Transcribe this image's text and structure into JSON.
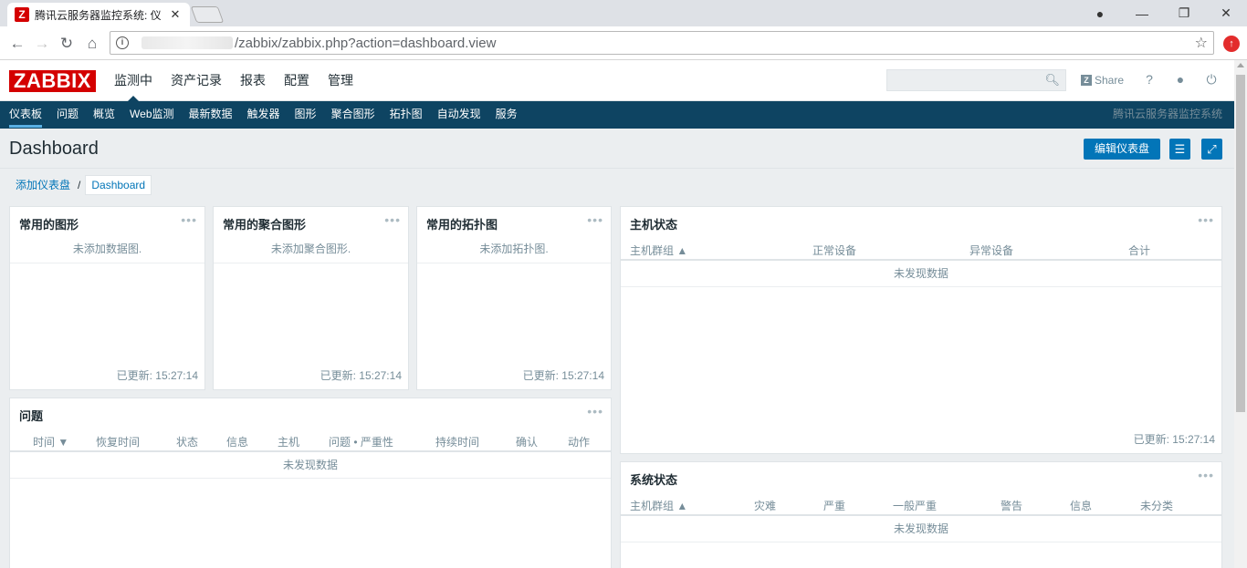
{
  "browser": {
    "tab_title": "腾讯云服务器监控系统: 仪",
    "favicon_letter": "Z",
    "url_path": "/zabbix/zabbix.php?action=dashboard.view"
  },
  "header": {
    "logo": "ZABBIX",
    "menu": [
      "监测中",
      "资产记录",
      "报表",
      "配置",
      "管理"
    ],
    "share_label": "Share",
    "help_label": "?"
  },
  "subnav": {
    "items": [
      "仪表板",
      "问题",
      "概览",
      "Web监测",
      "最新数据",
      "触发器",
      "图形",
      "聚合图形",
      "拓扑图",
      "自动发现",
      "服务"
    ],
    "server_name": "腾讯云服务器监控系统"
  },
  "page": {
    "title": "Dashboard",
    "edit_button": "编辑仪表盘",
    "breadcrumb_link": "添加仪表盘",
    "breadcrumb_current": "Dashboard"
  },
  "widgets": {
    "fav_graphs": {
      "title": "常用的图形",
      "empty": "未添加数据图.",
      "footer": "已更新: 15:27:14"
    },
    "fav_screens": {
      "title": "常用的聚合图形",
      "empty": "未添加聚合图形.",
      "footer": "已更新: 15:27:14"
    },
    "fav_maps": {
      "title": "常用的拓扑图",
      "empty": "未添加拓扑图.",
      "footer": "已更新: 15:27:14"
    },
    "host_status": {
      "title": "主机状态",
      "columns": [
        "主机群组 ▲",
        "正常设备",
        "异常设备",
        "合计"
      ],
      "empty": "未发现数据",
      "footer": "已更新: 15:27:14"
    },
    "problems": {
      "title": "问题",
      "columns": [
        "时间 ▼",
        "恢复时间",
        "状态",
        "信息",
        "主机",
        "问题 • 严重性",
        "持续时间",
        "确认",
        "动作"
      ],
      "empty": "未发现数据"
    },
    "system_status": {
      "title": "系统状态",
      "columns": [
        "主机群组 ▲",
        "灾难",
        "严重",
        "一般严重",
        "警告",
        "信息",
        "未分类"
      ],
      "empty": "未发现数据"
    }
  },
  "colors": {
    "brand": "#d40000",
    "nav": "#0e4462",
    "accent": "#0275b8"
  }
}
